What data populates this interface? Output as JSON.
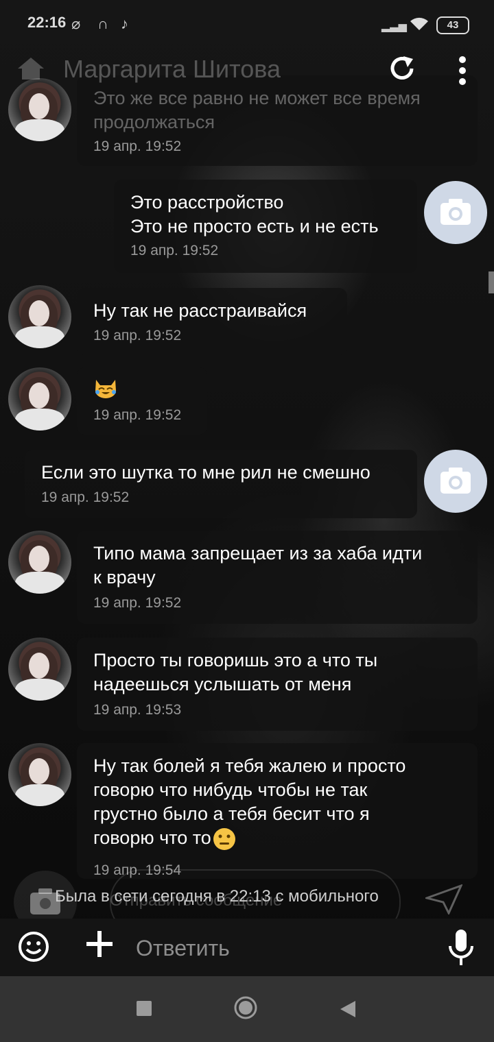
{
  "status_bar": {
    "time": "22:16",
    "battery": "43"
  },
  "header": {
    "title": "Маргарита Шитова"
  },
  "messages": [
    {
      "side": "in",
      "text": "Это же все равно не может все время\nпродолжаться",
      "time": "19 апр. 19:52"
    },
    {
      "side": "out",
      "text": "Это расстройство\nЭто не просто есть и не есть",
      "time": "19 апр. 19:52"
    },
    {
      "side": "in",
      "text": "Ну так не расстраивайся",
      "time": "19 апр. 19:52"
    },
    {
      "side": "in",
      "text": "",
      "emoji": "cat-tears-of-joy",
      "time": "19 апр. 19:52"
    },
    {
      "side": "out",
      "text": "Если это шутка то мне рил не смешно",
      "time": "19 апр. 19:52"
    },
    {
      "side": "in",
      "text": "Типо мама запрещает из за хаба идти\nк врачу",
      "time": "19 апр. 19:52"
    },
    {
      "side": "in",
      "text": "Просто ты говоришь это а что ты\nнадеешься услышать от меня",
      "time": "19 апр. 19:53"
    },
    {
      "side": "in",
      "text": "Ну так болей я тебя жалею и просто\nговорю что нибудь чтобы не так\nгрустно было а тебя бесит что я\nговорю что то",
      "emoji": "neutral-face",
      "time": "19 апр. 19:54"
    }
  ],
  "last_seen": "Была в сети сегодня в 22:13 с мобильного",
  "bg_input_placeholder": "Отправить сообщение",
  "input": {
    "placeholder": "Ответить"
  },
  "colors": {
    "bubble": "#121212",
    "camera_avatar": "#cfd8e6",
    "timestamp": "#9a9a9a"
  }
}
